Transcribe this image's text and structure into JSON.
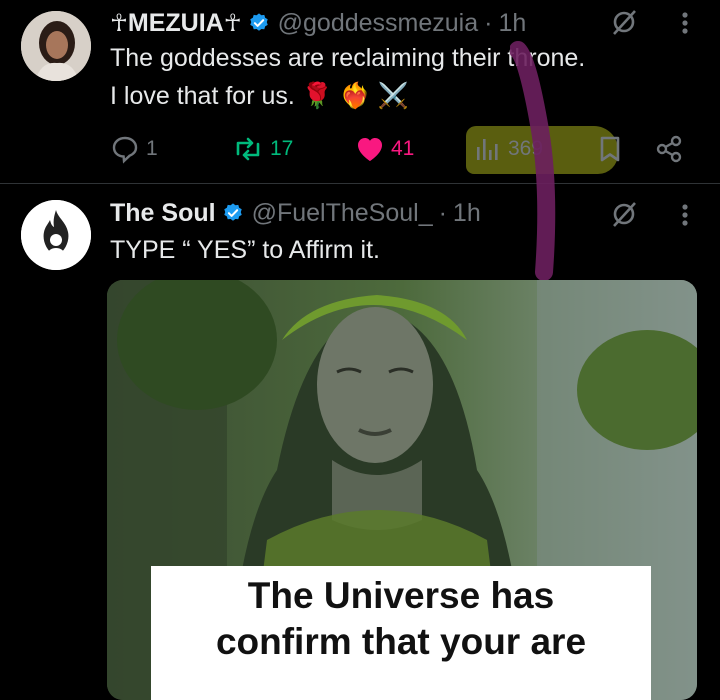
{
  "tweets": [
    {
      "name": "MEZUIA",
      "name_prefix_glyph": "☥",
      "name_suffix_glyph": "☥",
      "handle": "@goddessmezuia",
      "separator": "·",
      "time": "1h",
      "text_line1": "The goddesses are reclaiming their throne.",
      "text_line2": "I love that for us. 🌹 ❤️‍🔥 ⚔️",
      "replies": "1",
      "reposts": "17",
      "likes": "41",
      "views": "369"
    },
    {
      "name": "The Soul",
      "handle": "@FuelTheSoul_",
      "separator": "·",
      "time": "1h",
      "text": "TYPE “ YES” to Affirm it.",
      "image_caption_line1": "The Universe has",
      "image_caption_line2": "confirm that your are"
    }
  ],
  "colors": {
    "verified": "#1d9bf0",
    "reposts": "#00ba7c",
    "likes": "#f91880",
    "secondary_text": "#71767b",
    "highlight": "#7d7d14",
    "pen_mark": "#6b1f5e"
  }
}
